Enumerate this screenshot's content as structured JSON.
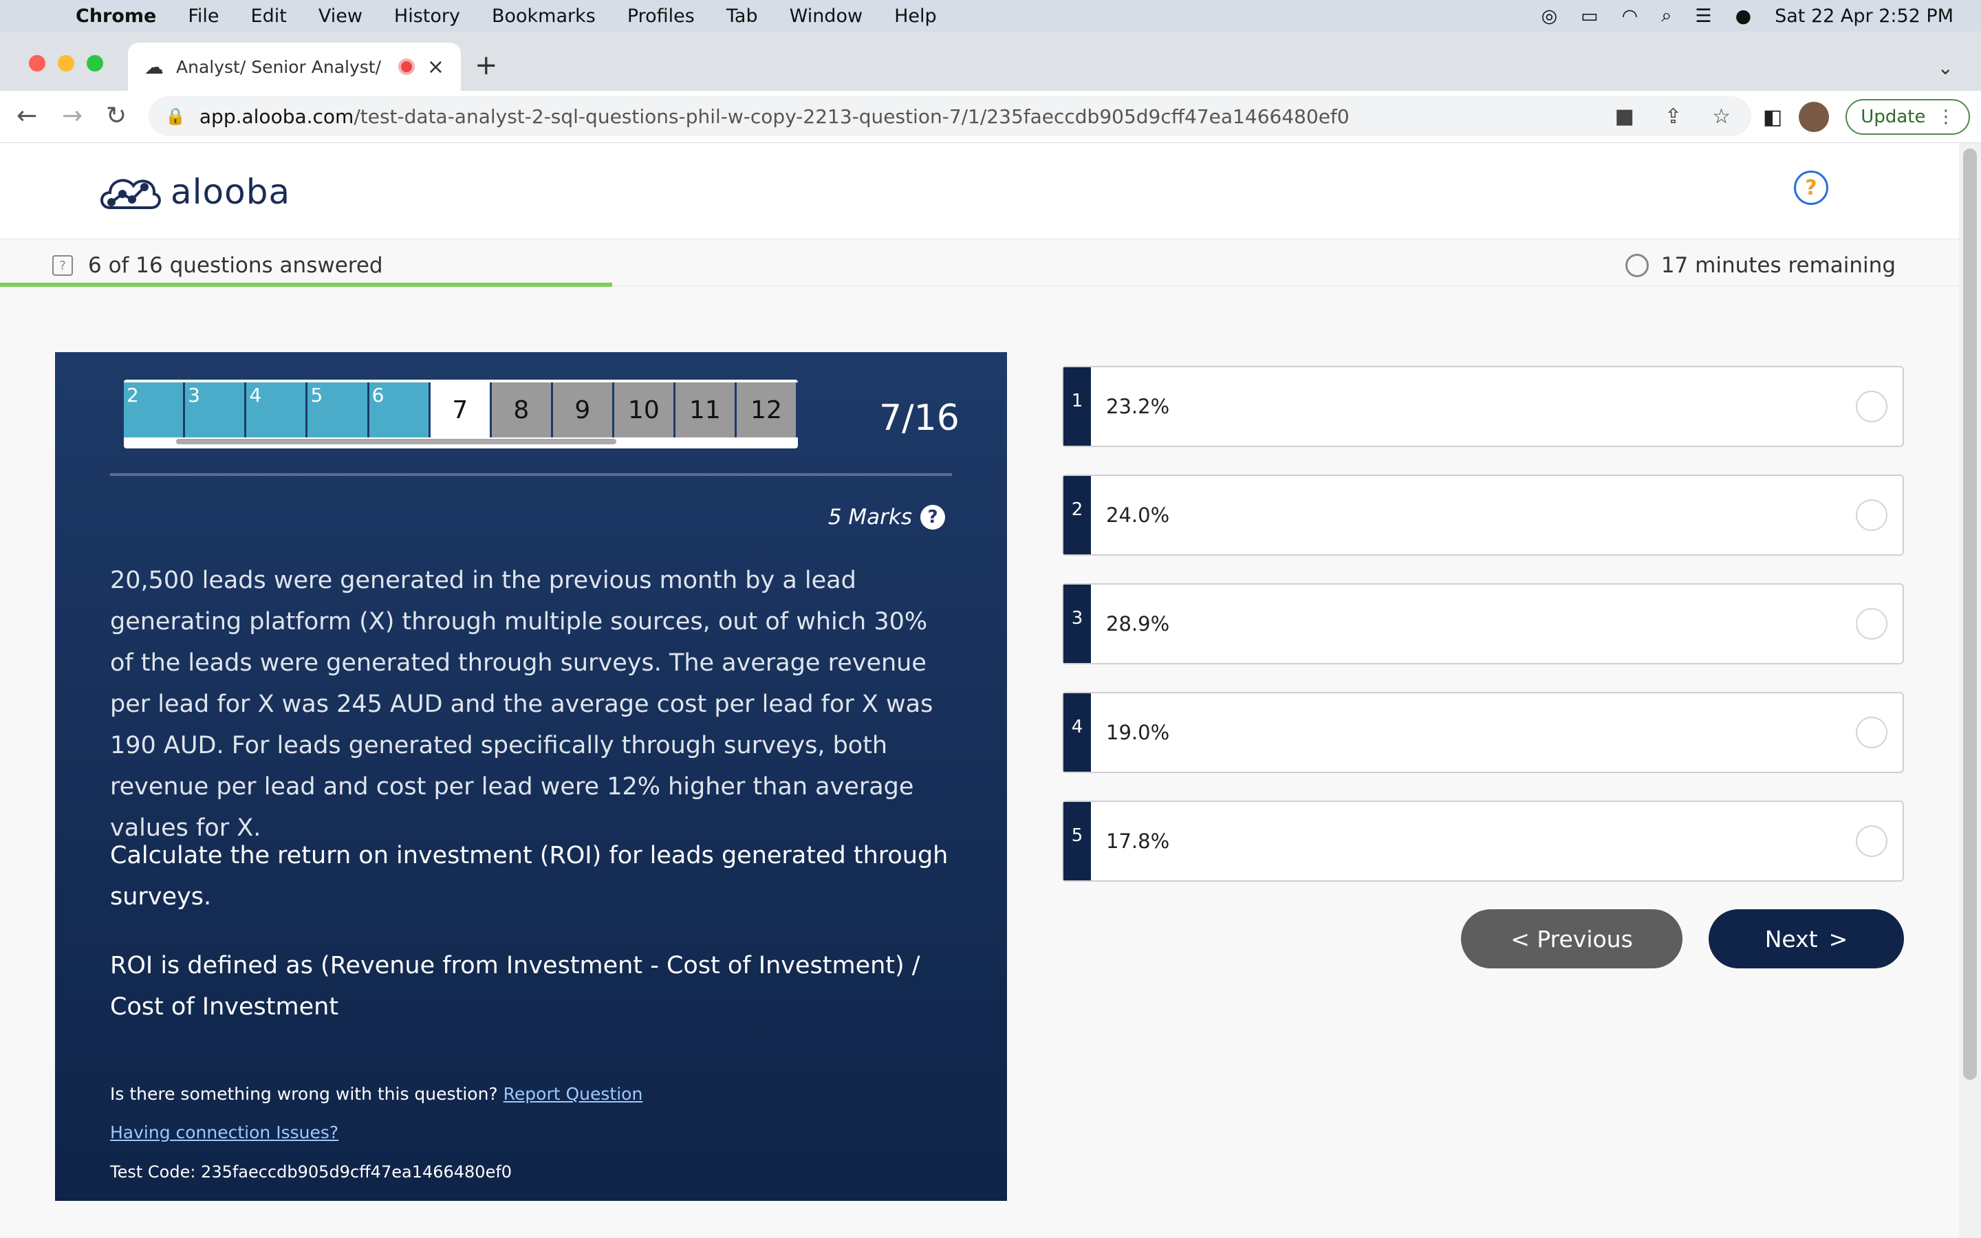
{
  "menubar": {
    "apple": "",
    "items": [
      "Chrome",
      "File",
      "Edit",
      "View",
      "History",
      "Bookmarks",
      "Profiles",
      "Tab",
      "Window",
      "Help"
    ],
    "datetime": "Sat 22 Apr  2:52 PM"
  },
  "browser": {
    "tab_title": "Analyst/ Senior Analyst/ As",
    "url_host": "app.alooba.com",
    "url_path": "/test-data-analyst-2-sql-questions-phil-w-copy-2213-question-7/1/235faeccdb905d9cff47ea1466480ef0",
    "update_label": "Update"
  },
  "header": {
    "logo_text": "alooba",
    "help_symbol": "?"
  },
  "progress": {
    "answered_text": "6 of 16 questions answered",
    "answered_fraction": 0.3125,
    "remaining_text": "17 minutes remaining"
  },
  "question": {
    "nav_done": [
      "2",
      "3",
      "4",
      "5",
      "6"
    ],
    "nav_current": "7",
    "nav_todo": [
      "8",
      "9",
      "10",
      "11",
      "12"
    ],
    "counter": "7/16",
    "marks": "5 Marks",
    "marks_help": "?",
    "paragraph1": "20,500 leads were generated in the previous month by a lead generating platform (X) through multiple sources, out of which 30% of the leads were generated through surveys. The average revenue per lead for X was 245 AUD and the average cost per lead for X was 190 AUD. For leads generated specifically through surveys, both revenue per lead and cost per lead were 12% higher than average values for X.",
    "paragraph2": "Calculate the return on investment (ROI) for leads generated through surveys.",
    "paragraph3": "ROI is defined as (Revenue from Investment - Cost of Investment) / Cost of Investment",
    "report_prefix": "Is there something wrong with this question?",
    "report_link": "Report Question",
    "connection_link": "Having connection Issues?",
    "test_code": "Test Code: 235faeccdb905d9cff47ea1466480ef0"
  },
  "options": [
    {
      "num": "1",
      "value": "23.2%"
    },
    {
      "num": "2",
      "value": "24.0%"
    },
    {
      "num": "3",
      "value": "28.9%"
    },
    {
      "num": "4",
      "value": "19.0%"
    },
    {
      "num": "5",
      "value": "17.8%"
    }
  ],
  "buttons": {
    "previous": "< Previous",
    "next": "Next",
    "next_arrow": ">"
  },
  "colors": {
    "panel": "#0f2448",
    "done": "#4aacc9",
    "progress": "#7bcf5a"
  }
}
